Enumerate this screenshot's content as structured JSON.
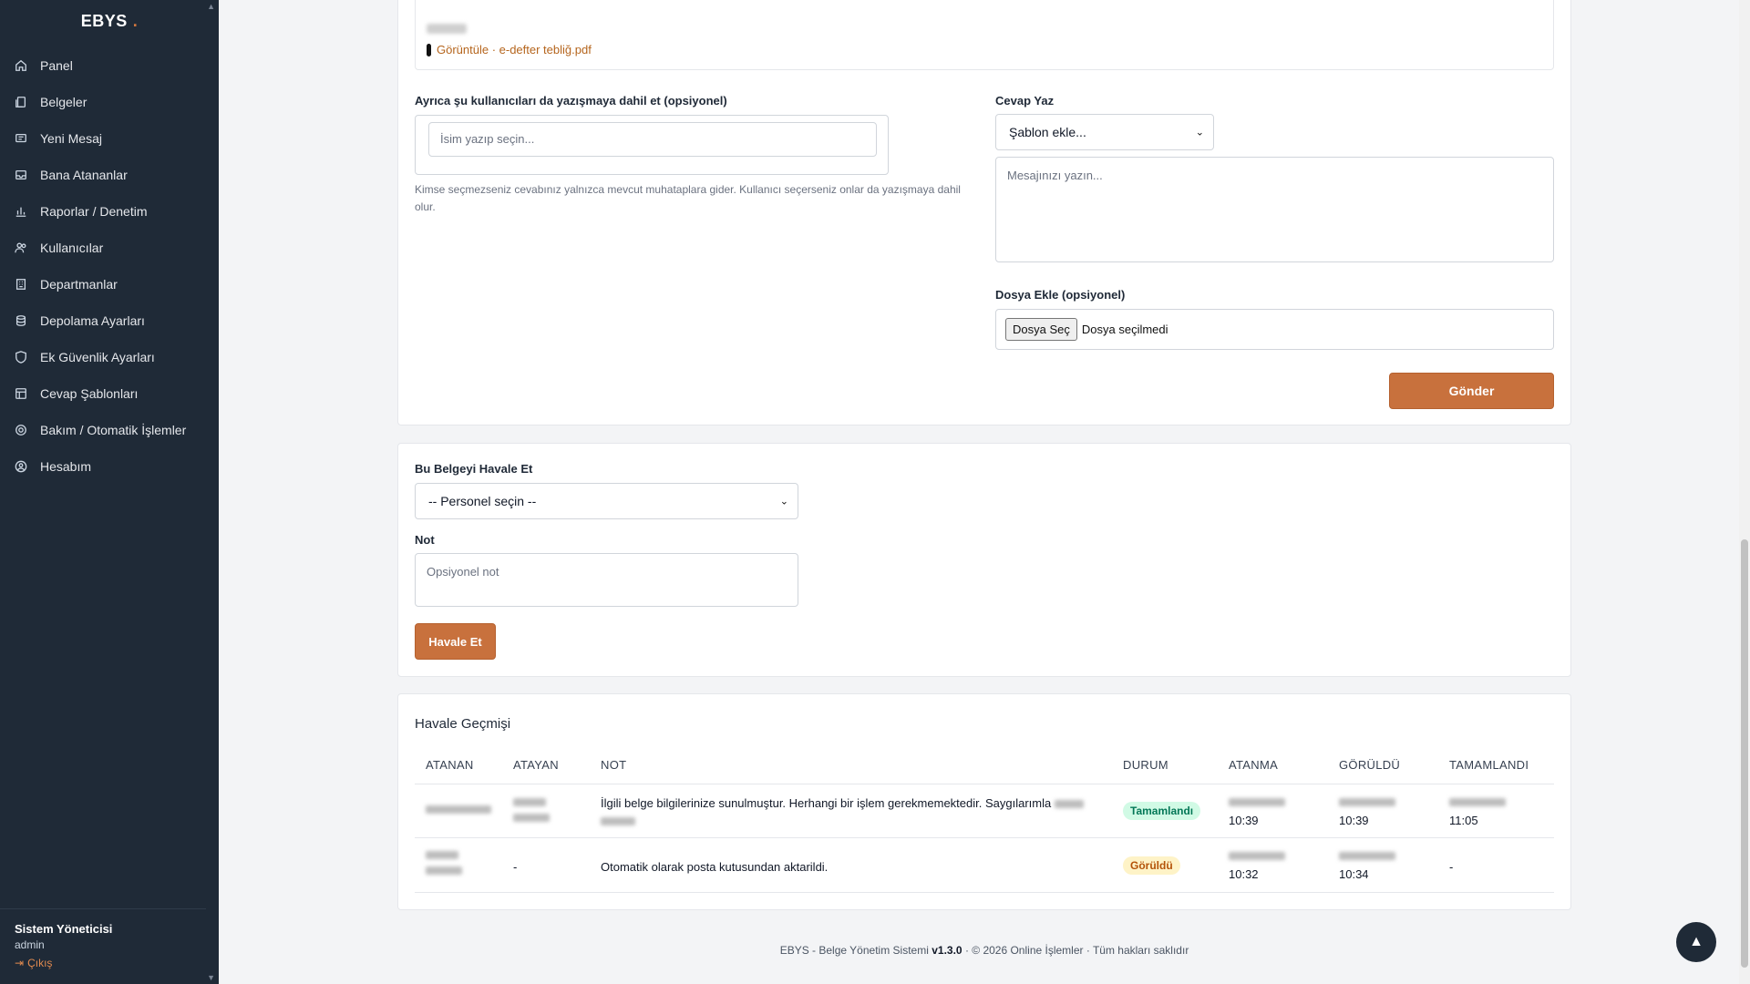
{
  "sidebar": {
    "brand": "EBYS",
    "brand_dot": ".",
    "items": [
      {
        "label": "Panel",
        "icon": "home-icon"
      },
      {
        "label": "Belgeler",
        "icon": "documents-icon"
      },
      {
        "label": "Yeni Mesaj",
        "icon": "message-icon"
      },
      {
        "label": "Bana Atananlar",
        "icon": "inbox-icon"
      },
      {
        "label": "Raporlar / Denetim",
        "icon": "chart-icon"
      },
      {
        "label": "Kullanıcılar",
        "icon": "users-icon"
      },
      {
        "label": "Departmanlar",
        "icon": "building-icon"
      },
      {
        "label": "Depolama Ayarları",
        "icon": "database-icon"
      },
      {
        "label": "Ek Güvenlik Ayarları",
        "icon": "shield-icon"
      },
      {
        "label": "Cevap Şablonları",
        "icon": "template-icon"
      },
      {
        "label": "Bakım / Otomatik İşlemler",
        "icon": "gear-icon"
      },
      {
        "label": "Hesabım",
        "icon": "user-circle-icon"
      }
    ],
    "user_name": "Sistem Yöneticisi",
    "user_role": "admin",
    "logout_label": "Çıkış"
  },
  "message": {
    "attachment_link": "Görüntüle · e-defter tebliğ.pdf"
  },
  "reply_form": {
    "include_users_label": "Ayrıca şu kullanıcıları da yazışmaya dahil et (opsiyonel)",
    "include_users_placeholder": "İsim yazıp seçin...",
    "include_users_help": "Kimse seçmezseniz cevabınız yalnızca mevcut muhataplara gider. Kullanıcı seçerseniz onlar da yazışmaya dahil olur.",
    "reply_label": "Cevap Yaz",
    "template_select": "Şablon ekle...",
    "message_placeholder": "Mesajınızı yazın...",
    "file_label": "Dosya Ekle (opsiyonel)",
    "file_button": "Dosya Seç",
    "file_status": "Dosya seçilmedi",
    "send_button": "Gönder"
  },
  "forward_form": {
    "title": "Bu Belgeyi Havale Et",
    "personnel_select": "-- Personel seçin --",
    "note_label": "Not",
    "note_placeholder": "Opsiyonel not",
    "submit_button": "Havale Et"
  },
  "history": {
    "title": "Havale Geçmişi",
    "columns": [
      "ATANAN",
      "ATAYAN",
      "NOT",
      "DURUM",
      "ATANMA",
      "GÖRÜLDÜ",
      "TAMAMLANDI"
    ],
    "rows": [
      {
        "atayan": "",
        "not": "İlgili belge bilgilerinize sunulmuştur. Herhangi bir işlem gerekmemektedir. Saygılarımla",
        "durum": "Tamamlandı",
        "atanma_time": "10:39",
        "goruldu_time": "10:39",
        "tamamlandi": "11:05",
        "status_color": "#047857"
      },
      {
        "atayan": "-",
        "not": "Otomatik olarak posta kutusundan aktarildi.",
        "durum": "Görüldü",
        "atanma_time": "10:32",
        "goruldu_time": "10:34",
        "tamamlandi": "-",
        "status_color": "#b45309"
      }
    ]
  },
  "footer": {
    "app": "EBYS - Belge Yönetim Sistemi",
    "version": "v1.3.0",
    "copyright": "· © 2026 Online İşlemler · Tüm hakları saklıdır"
  },
  "colors": {
    "accent": "#c8713d",
    "sidebar_bg": "#1f2a37"
  }
}
